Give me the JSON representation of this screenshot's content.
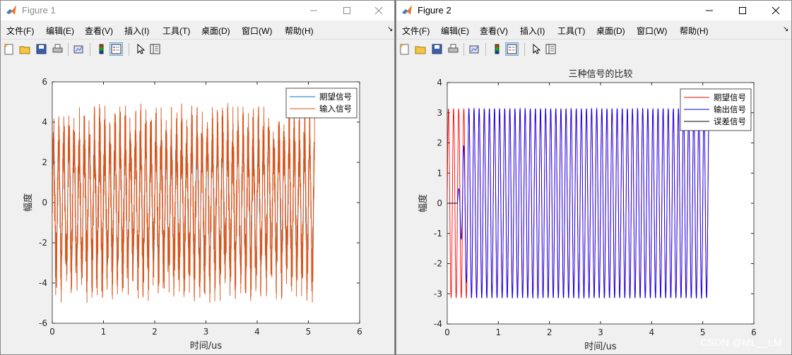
{
  "windows": [
    {
      "title": "Figure 1",
      "menu": [
        "文件(F)",
        "编辑(E)",
        "查看(V)",
        "插入(I)",
        "工具(T)",
        "桌面(D)",
        "窗口(W)",
        "帮助(H)"
      ],
      "toolbar_icons": [
        "new-figure-icon",
        "open-icon",
        "save-icon",
        "print-icon",
        "link-plot-icon",
        "colorbar-icon",
        "legend-icon",
        "edit-plot-arrow-icon",
        "property-inspector-icon"
      ]
    },
    {
      "title": "Figure 2",
      "menu": [
        "文件(F)",
        "编辑(E)",
        "查看(V)",
        "插入(I)",
        "工具(T)",
        "桌面(D)",
        "窗口(W)",
        "帮助(H)"
      ],
      "toolbar_icons": [
        "new-figure-icon",
        "open-icon",
        "save-icon",
        "print-icon",
        "link-plot-icon",
        "colorbar-icon",
        "legend-icon",
        "edit-plot-arrow-icon",
        "property-inspector-icon"
      ]
    }
  ],
  "chart_data": [
    {
      "type": "line",
      "title": "",
      "xlabel": "时间/us",
      "ylabel": "幅度",
      "xlim": [
        0,
        6
      ],
      "ylim": [
        -6,
        6
      ],
      "xticks": [
        0,
        1,
        2,
        3,
        4,
        5,
        6
      ],
      "yticks": [
        -6,
        -4,
        -2,
        0,
        2,
        4,
        6
      ],
      "x_end": 5.12,
      "legend_position": "top-right",
      "series": [
        {
          "name": "期望信号",
          "color": "#0072bd",
          "kind": "sine",
          "amplitude": 3.14,
          "period_us": 0.1
        },
        {
          "name": "输入信号",
          "color": "#d95319",
          "kind": "noisy-sine",
          "amplitude": 3.14,
          "noise_peak": 2.1,
          "period_us": 0.1,
          "min": -5.3,
          "max": 5.3
        }
      ]
    },
    {
      "type": "line",
      "title": "三种信号的比较",
      "xlabel": "时间/us",
      "ylabel": "幅度",
      "xlim": [
        0,
        6
      ],
      "ylim": [
        -4,
        4
      ],
      "xticks": [
        0,
        1,
        2,
        3,
        4,
        5,
        6
      ],
      "yticks": [
        -4,
        -3,
        -2,
        -1,
        0,
        1,
        2,
        3,
        4
      ],
      "x_end": 5.12,
      "legend_position": "top-right",
      "series": [
        {
          "name": "期望信号",
          "color": "#ff0000",
          "kind": "sine",
          "amplitude": 3.14,
          "period_us": 0.1
        },
        {
          "name": "输出信号",
          "color": "#0000ff",
          "kind": "converging-sine",
          "amplitude": 3.14,
          "period_us": 0.1
        },
        {
          "name": "误差信号",
          "color": "#000000",
          "kind": "decaying-error",
          "peaks": [
            1.95,
            -3.1,
            0.8,
            0.3
          ]
        }
      ]
    }
  ],
  "watermark": "CSDN @ML__LM"
}
